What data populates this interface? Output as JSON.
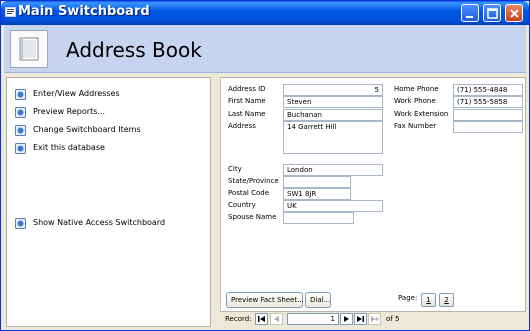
{
  "window": {
    "title": "Main Switchboard"
  },
  "header": {
    "title": "Address Book"
  },
  "menu": {
    "items": [
      {
        "label": "Enter/View Addresses"
      },
      {
        "label": "Preview Reports..."
      },
      {
        "label": "Change Switchboard Items"
      },
      {
        "label": "Exit this database"
      }
    ],
    "native_label": "Show Native Access Switchboard"
  },
  "form": {
    "labels": {
      "address_id": "Address ID",
      "first_name": "First Name",
      "last_name": "Last Name",
      "address": "Address",
      "city": "City",
      "state": "State/Province",
      "postal": "Postal Code",
      "country": "Country",
      "spouse": "Spouse Name",
      "home_phone": "Home Phone",
      "work_phone": "Work Phone",
      "work_ext": "Work Extension",
      "fax": "Fax Number"
    },
    "values": {
      "address_id": "5",
      "first_name": "Steven",
      "last_name": "Buchanan",
      "address": "14 Garrett Hill",
      "city": "London",
      "state": "",
      "postal": "SW1 8JR",
      "country": "UK",
      "spouse": "",
      "home_phone": "(71) 555-4848",
      "work_phone": "(71) 555-5858",
      "work_ext": "",
      "fax": ""
    },
    "buttons": {
      "preview": "Preview Fact Sheet...",
      "dial": "Dial..."
    },
    "page_label": "Page:",
    "pages": [
      "1",
      "2"
    ]
  },
  "navigator": {
    "label": "Record:",
    "current": "1",
    "of_text": "of 5"
  },
  "colors": {
    "titlebar": "#0058e6",
    "header": "#c6d4f0",
    "icon_blue": "#3a7bd5"
  }
}
